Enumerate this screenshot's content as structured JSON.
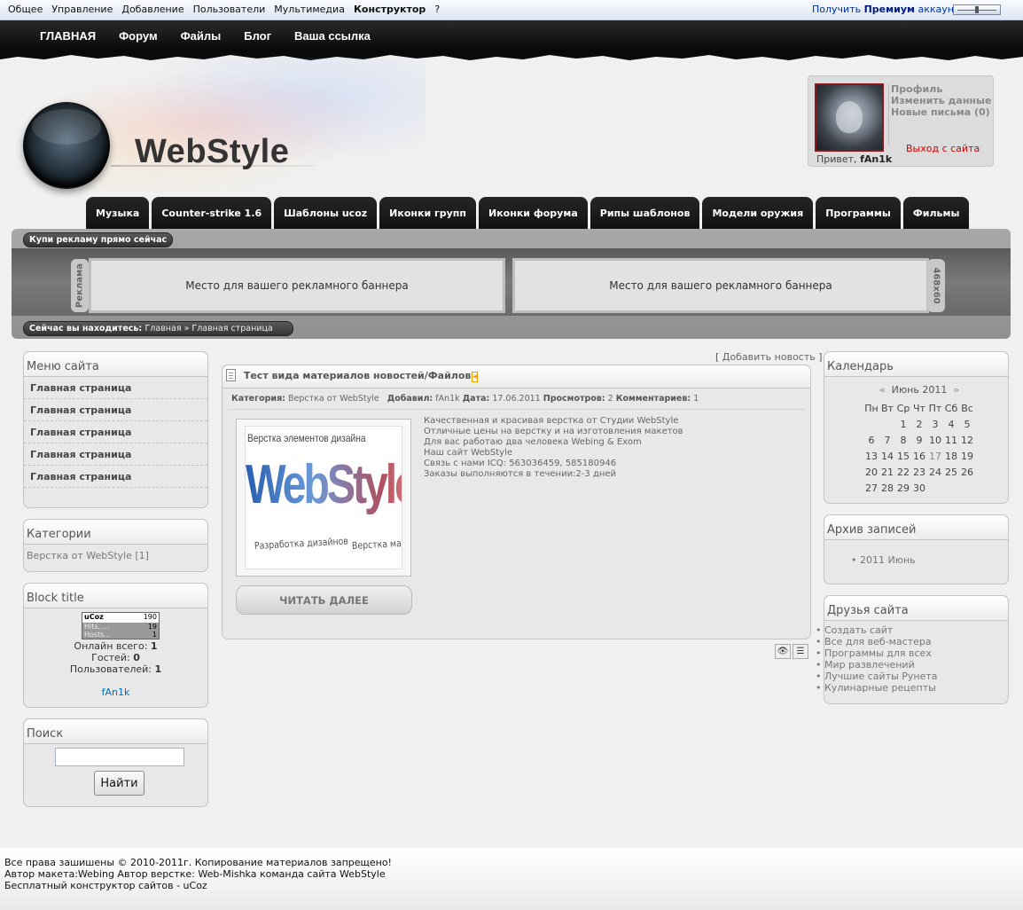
{
  "adminbar": {
    "menu": [
      "Общее",
      "Управление",
      "Добавление",
      "Пользователи",
      "Мультимедиа",
      "Конструктор",
      "?"
    ],
    "premium_prefix": "Получить",
    "premium_bold": "Премиум",
    "premium_suffix": "аккаунт"
  },
  "topnav": [
    "ГЛАВНАЯ",
    "Форум",
    "Файлы",
    "Блог",
    "Ваша ссылка"
  ],
  "site": {
    "logo_text": "WebStyle"
  },
  "user": {
    "links": [
      "Профиль",
      "Изменить данные",
      "Новые письма (0)"
    ],
    "logout": "Выход с сайта",
    "greeting": "Привет,",
    "username": "fAn1k"
  },
  "tabs": [
    "Музыка",
    "Counter-strike 1.6",
    "Шаблоны ucoz",
    "Иконки групп",
    "Иконки форума",
    "Рипы шаблонов",
    "Модели оружия",
    "Программы",
    "Фильмы"
  ],
  "ads": {
    "buy_label": "Купи рекламу прямо сейчас",
    "left_label": "Реклама",
    "right_label": "468x60",
    "banner1": "Место для вашего рекламного баннера",
    "banner2": "Место для вашего рекламного баннера"
  },
  "breadcrumb": {
    "label": "Сейчас вы находитесь:",
    "path": "Главная » Главная страница"
  },
  "site_menu": {
    "title": "Меню сайта",
    "items": [
      "Главная страница",
      "Главная страница",
      "Главная страница",
      "Главная страница",
      "Главная страница"
    ]
  },
  "categories": {
    "title": "Категории",
    "item": "Верстка от WebStyle [1]"
  },
  "stats": {
    "title": "Block title",
    "counter_logo": "uCoz",
    "counter_total": "190",
    "hits_label": "Hits.....",
    "hits": "19",
    "hosts_label": "Hosts...",
    "hosts": "1",
    "online_label": "Онлайн всего:",
    "online": "1",
    "guests_label": "Гостей:",
    "guests": "0",
    "users_label": "Пользователей:",
    "users": "1",
    "user_name": "fAn1k"
  },
  "search": {
    "title": "Поиск",
    "value": "",
    "button": "Найти"
  },
  "content": {
    "add_news": "Добавить новость",
    "entry": {
      "title": "Тест вида материалов новостей/Файлов",
      "cat_label": "Категория:",
      "cat": "Верстка от WebStyle",
      "added_label": "Добавил:",
      "added": "fAn1k",
      "date_label": "Дата:",
      "date": "17.06.2011",
      "views_label": "Просмотров:",
      "views": "2",
      "comments_label": "Комментариев:",
      "comments": "1",
      "image_caption_top": "Верстка элементов дизайна",
      "image_logo": "WebStyle",
      "image_caption_left": "Разработка дизайнов",
      "image_caption_right": "Верстка макетов",
      "text": [
        "Качественная и красивая верстка от Студии WebStyle",
        "Отличные цены на верстку и на изготовления макетов",
        "Для вас работаю два человека Webing & Exom",
        "Наш сайт WebStyle",
        "Связь с нами ICQ: 563036459, 585180946",
        "Заказы выполняются в течении:2-3 дней"
      ],
      "read_more": "ЧИТАТЬ ДАЛЕЕ"
    }
  },
  "calendar": {
    "title": "Календарь",
    "prev": "«",
    "month": "Июнь 2011",
    "next": "»",
    "weekdays": [
      "Пн",
      "Вт",
      "Ср",
      "Чт",
      "Пт",
      "Сб",
      "Вс"
    ],
    "weeks": [
      [
        "",
        "",
        "1",
        "2",
        "3",
        "4",
        "5"
      ],
      [
        "6",
        "7",
        "8",
        "9",
        "10",
        "11",
        "12"
      ],
      [
        "13",
        "14",
        "15",
        "16",
        "17",
        "18",
        "19"
      ],
      [
        "20",
        "21",
        "22",
        "23",
        "24",
        "25",
        "26"
      ],
      [
        "27",
        "28",
        "29",
        "30",
        "",
        "",
        ""
      ]
    ]
  },
  "archive": {
    "title": "Архив записей",
    "item": "2011 Июнь"
  },
  "friends": {
    "title": "Друзья сайта",
    "items": [
      "Создать сайт",
      "Все для веб-мастера",
      "Программы для всех",
      "Мир развлечений",
      "Лучшие сайты Рунета",
      "Кулинарные рецепты"
    ]
  },
  "footer": {
    "lines": [
      "Все права зашишены © 2010-2011г. Копирование материалов запрещено!",
      "Автор макета:Webing Автор верстке: Web-Mishka команда сайта WebStyle",
      "Бесплатный конструктор сайтов - uCoz"
    ]
  }
}
